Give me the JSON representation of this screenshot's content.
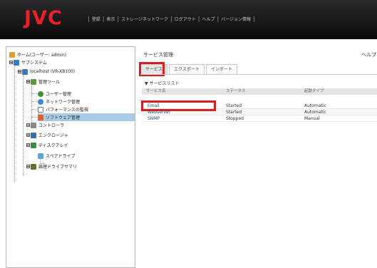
{
  "header": {
    "logo": "JVC",
    "menu": [
      "登録",
      "表示",
      "ストレージネットワーク",
      "ログアウト",
      "ヘルプ",
      "バージョン情報"
    ]
  },
  "tree": {
    "home": "ホーム(ユーザー: admin)",
    "subsystem": "サブシステム",
    "host": "localhost (VR-XB100)",
    "mgmt_tools": "管理ツール",
    "user_mgmt": "ユーザー管理",
    "network_mgmt": "ネットワーク管理",
    "perf_monitor": "パフォーマンスの監視",
    "software_mgmt": "ソフトウェア管理",
    "controller": "コントローラ",
    "enclosure": "エンクロージャ",
    "disk_array": "ディスクアレイ",
    "spare_drive": "スペアドライブ",
    "logical_drive_summary": "論理ドライブサマリ"
  },
  "main": {
    "title": "サービス管理",
    "help": "ヘルプ",
    "tabs": [
      "サービス",
      "エクスポート",
      "インポート"
    ],
    "active_tab": "サービス",
    "list_title": "▼ サービスリスト",
    "columns": [
      "サービス名",
      "ステータス",
      "起動タイプ"
    ],
    "rows": [
      {
        "name": "Email",
        "status": "Started",
        "startup": "Automatic"
      },
      {
        "name": "Webserver",
        "status": "Started",
        "startup": "Automatic"
      },
      {
        "name": "SNMP",
        "status": "Stopped",
        "startup": "Manual"
      }
    ]
  },
  "colors": {
    "header_bg": "#111111",
    "logo_red": "#e8202a",
    "highlight_red": "#d42020",
    "tree_selected": "#a9cbe6"
  }
}
